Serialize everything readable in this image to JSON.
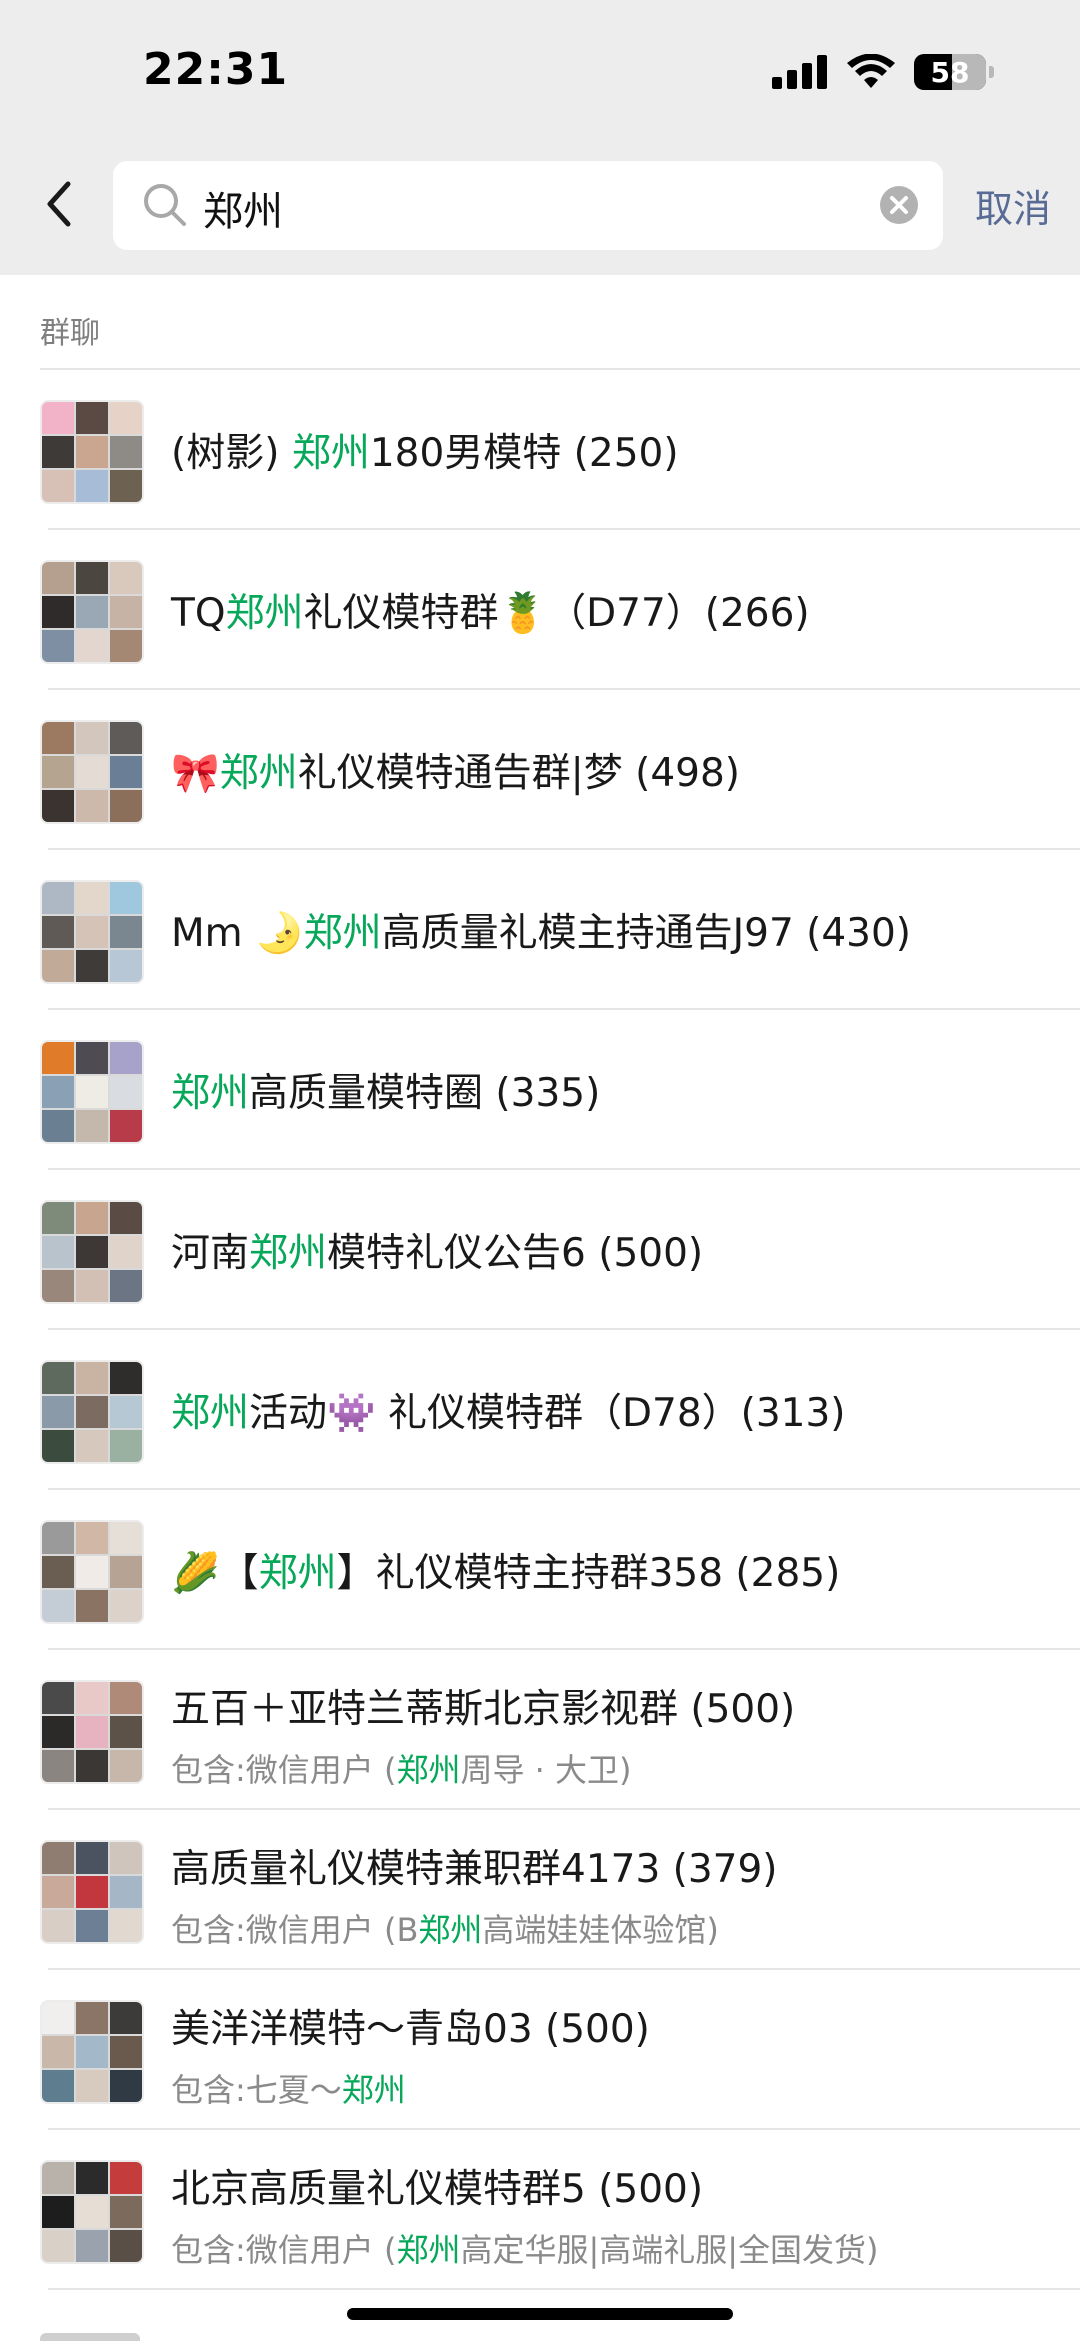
{
  "status_bar": {
    "time": "22:31",
    "battery": "58"
  },
  "search": {
    "query": "郑州",
    "cancel_label": "取消"
  },
  "section": {
    "label": "群聊"
  },
  "groups": [
    {
      "parts": [
        [
          "(树影) ",
          ""
        ],
        [
          "郑州",
          "hl"
        ],
        [
          "180男模特 (250)",
          ""
        ]
      ],
      "sub": null,
      "avatar": [
        "#f2b3c8",
        "#5b4a43",
        "#e7d2c7",
        "#3e3a38",
        "#caa58f",
        "#8e8a86",
        "#d7c1b6",
        "#a7bcd6",
        "#6d6152"
      ]
    },
    {
      "parts": [
        [
          "TQ",
          ""
        ],
        [
          "郑州",
          "hl"
        ],
        [
          "礼仪模特群🍍（D77）(266)",
          ""
        ]
      ],
      "sub": null,
      "avatar": [
        "#b59f8f",
        "#4c4640",
        "#d9c8bc",
        "#2f2b2a",
        "#9aa7b5",
        "#c7b3a5",
        "#7f8fa3",
        "#e2d6cf",
        "#a58873"
      ]
    },
    {
      "parts": [
        [
          "🎀",
          ""
        ],
        [
          "郑州",
          "hl"
        ],
        [
          "礼仪模特通告群|梦 (498)",
          ""
        ]
      ],
      "sub": null,
      "avatar": [
        "#9c7a62",
        "#d2c6bd",
        "#5e5b58",
        "#b5a48f",
        "#e4dbd4",
        "#6a7e96",
        "#3a3330",
        "#ccb9ab",
        "#8c6f5b"
      ]
    },
    {
      "parts": [
        [
          "Mm 🌛",
          ""
        ],
        [
          "郑州",
          "hl"
        ],
        [
          "高质量礼模主持通告J97 (430)",
          ""
        ]
      ],
      "sub": null,
      "avatar": [
        "#aeb8c4",
        "#e3d6cb",
        "#9fc7de",
        "#5f5a55",
        "#d4c3b6",
        "#7a8690",
        "#c1aa97",
        "#3f3b38",
        "#b8c7d5"
      ]
    },
    {
      "parts": [
        [
          "郑州",
          "hl"
        ],
        [
          "高质量模特圈 (335)",
          ""
        ]
      ],
      "sub": null,
      "avatar": [
        "#e07b2a",
        "#4e4b52",
        "#a6a2c9",
        "#8aa0b4",
        "#efece6",
        "#d9dde2",
        "#6b7f93",
        "#c4b7ab",
        "#b83b4a"
      ]
    },
    {
      "parts": [
        [
          "河南",
          ""
        ],
        [
          "郑州",
          "hl"
        ],
        [
          "模特礼仪公告6 (500)",
          ""
        ]
      ],
      "sub": null,
      "avatar": [
        "#7e8a7a",
        "#c8a58e",
        "#5a4c44",
        "#b9c3cc",
        "#3d3835",
        "#e0d4ca",
        "#98877a",
        "#d1c0b3",
        "#6b7584"
      ]
    },
    {
      "parts": [
        [
          "郑州",
          "hl"
        ],
        [
          "活动👾 礼仪模特群（D78）(313)",
          ""
        ]
      ],
      "sub": null,
      "avatar": [
        "#5f6a5e",
        "#c9b3a3",
        "#2f2d2c",
        "#8b9aa8",
        "#7c6b60",
        "#b5c8d4",
        "#3b4b3d",
        "#d6c8bd",
        "#9ab0a0"
      ]
    },
    {
      "parts": [
        [
          "🌽【",
          ""
        ],
        [
          "郑州",
          "hl"
        ],
        [
          "】礼仪模特主持群358 (285)",
          ""
        ]
      ],
      "sub": null,
      "avatar": [
        "#9a9a9a",
        "#d1b8a6",
        "#e5dfd8",
        "#6a5d52",
        "#f0ebe6",
        "#b7a393",
        "#c4cdd6",
        "#8a7363",
        "#dcd2c9"
      ]
    },
    {
      "parts": [
        [
          "五百＋亚特兰蒂斯北京影视群 (500)",
          ""
        ]
      ],
      "sub": [
        [
          "包含:微信用户 (",
          ""
        ],
        [
          "郑州",
          "hl"
        ],
        [
          "周导 · 大卫)",
          ""
        ]
      ],
      "avatar": [
        "#4a4a4a",
        "#e8c9c8",
        "#b08a79",
        "#2c2a29",
        "#e7b3c0",
        "#5d5248",
        "#8b8581",
        "#3a3734",
        "#c6b7aa"
      ]
    },
    {
      "parts": [
        [
          "高质量礼仪模特兼职群4173 (379)",
          ""
        ]
      ],
      "sub": [
        [
          "包含:微信用户 (B",
          ""
        ],
        [
          "郑州",
          "hl"
        ],
        [
          "高端娃娃体验馆)",
          ""
        ]
      ],
      "avatar": [
        "#8f7d72",
        "#4b5361",
        "#cfc5bc",
        "#c9a99a",
        "#c2373d",
        "#a5b6c7",
        "#d8cec5",
        "#6c7f95",
        "#e1d8cf"
      ]
    },
    {
      "parts": [
        [
          "美洋洋模特～青岛03 (500)",
          ""
        ]
      ],
      "sub": [
        [
          "包含:七夏～",
          ""
        ],
        [
          "郑州",
          "hl"
        ]
      ],
      "avatar": [
        "#f1efed",
        "#8a7566",
        "#3d3b39",
        "#c9b8aa",
        "#a3b8c9",
        "#6a5a4e",
        "#5e7d8f",
        "#d7cabf",
        "#2f3a44"
      ]
    },
    {
      "parts": [
        [
          "北京高质量礼仪模特群5 (500)",
          ""
        ]
      ],
      "sub": [
        [
          "包含:微信用户 (",
          ""
        ],
        [
          "郑州",
          "hl"
        ],
        [
          "高定华服|高端礼服|全国发货)",
          ""
        ]
      ],
      "avatar": [
        "#b9b2ab",
        "#2b2b2b",
        "#c43c3c",
        "#1d1d1d",
        "#e6ddd5",
        "#7c6a5d",
        "#d9d0c8",
        "#9aa3ad",
        "#5a4f47"
      ]
    }
  ]
}
